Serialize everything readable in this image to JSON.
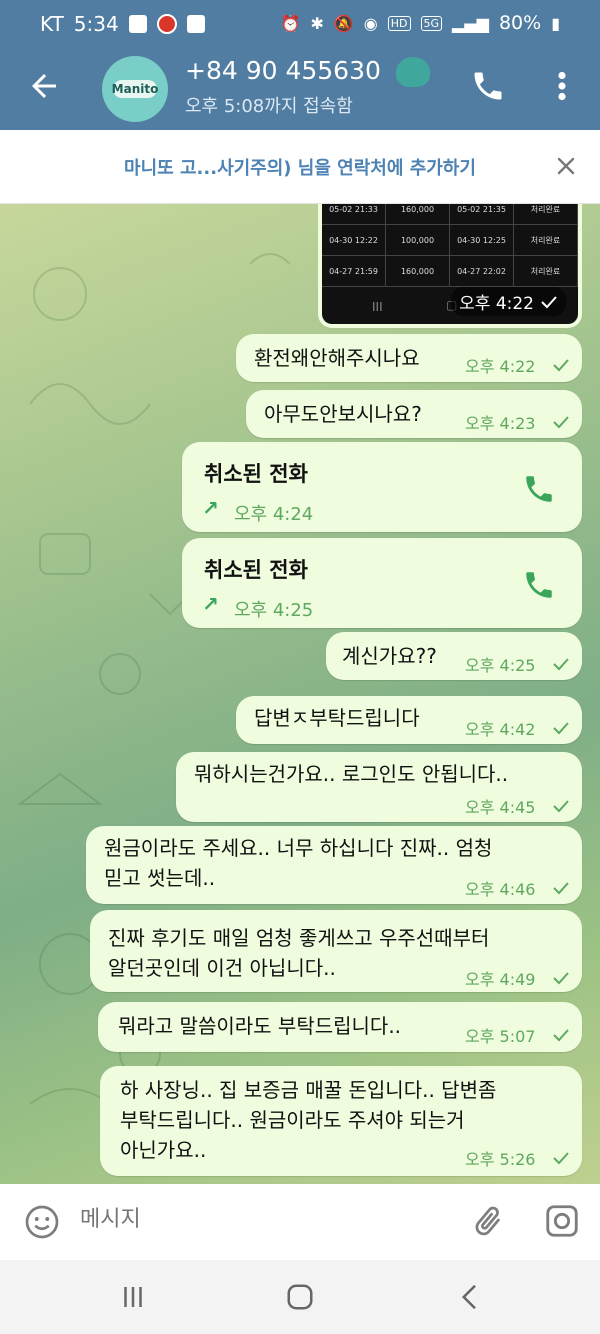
{
  "status_bar": {
    "carrier": "KT",
    "time": "5:34",
    "network": "5G",
    "hd": "HD",
    "battery": "80%"
  },
  "header": {
    "contact_name": "+84 90 455630",
    "last_seen": "오후 5:08까지 접속함",
    "avatar_text": "Manito"
  },
  "add_contact_bar": {
    "text": "마니또 고...사기주의) 님을 연락처에 추가하기"
  },
  "image_message": {
    "rows": [
      [
        "05-02 21:33",
        "160,000",
        "05-02 21:35",
        "처리완료"
      ],
      [
        "04-30 12:22",
        "100,000",
        "04-30 12:25",
        "처리완료"
      ],
      [
        "04-27 21:59",
        "160,000",
        "04-27 22:02",
        "처리완료"
      ]
    ],
    "time": "오후 4:22"
  },
  "messages": [
    {
      "text": "환전왜안해주시나요",
      "time": "오후 4:22"
    },
    {
      "text": "아무도안보시나요?",
      "time": "오후 4:23"
    },
    {
      "title": "취소된 전화",
      "time": "오후 4:24"
    },
    {
      "title": "취소된 전화",
      "time": "오후 4:25"
    },
    {
      "text": "계신가요??",
      "time": "오후 4:25"
    },
    {
      "text": "답변ㅈ부탁드립니다",
      "time": "오후 4:42"
    },
    {
      "text": "뭐하시는건가요.. 로그인도 안됩니다..",
      "time": "오후 4:45"
    },
    {
      "line1": "원금이라도 주세요.. 너무 하십니다 진짜.. 엄청",
      "line2": "믿고 썻는데..",
      "time": "오후 4:46"
    },
    {
      "line1": "진짜 후기도 매일 엄청 좋게쓰고 우주선때부터",
      "line2": "알던곳인데 이건 아닙니다..",
      "time": "오후 4:49"
    },
    {
      "text": "뭐라고 말씀이라도 부탁드립니다..",
      "time": "오후 5:07"
    },
    {
      "line1": "하 사장닝.. 집 보증금 매꿀 돈입니다.. 답변좀",
      "line2": "부탁드립니다.. 원금이라도 주셔야 되는거",
      "line3": "아닌가요..",
      "time": "오후 5:26"
    }
  ],
  "input": {
    "placeholder": "메시지"
  },
  "colors": {
    "header": "#517da2",
    "bubble": "#effdde",
    "time": "#5fa85f",
    "accent": "#4c82b4",
    "call_green": "#3ba55c"
  }
}
